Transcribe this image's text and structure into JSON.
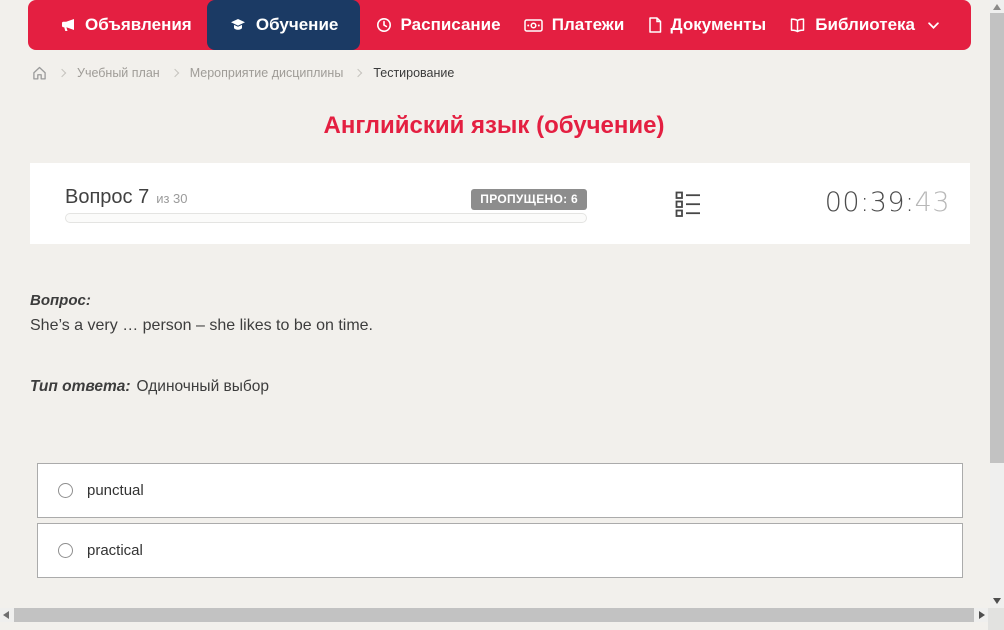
{
  "colors": {
    "accent_red": "#e41f41",
    "active_navy": "#1b3a64",
    "badge_gray": "#8d8d8d",
    "page_bg": "#f2f0ec"
  },
  "nav": {
    "items": [
      {
        "label": "Объявления",
        "icon": "megaphone-icon",
        "active": false
      },
      {
        "label": "Обучение",
        "icon": "graduation-cap-icon",
        "active": true
      },
      {
        "label": "Расписание",
        "icon": "clock-icon",
        "active": false
      },
      {
        "label": "Платежи",
        "icon": "cash-icon",
        "active": false
      },
      {
        "label": "Документы",
        "icon": "document-icon",
        "active": false
      },
      {
        "label": "Библиотека",
        "icon": "book-icon",
        "active": false,
        "has_dropdown": true,
        "dropdown_icon": "chevron-down-icon"
      }
    ]
  },
  "breadcrumb": {
    "home_icon": "home-icon",
    "items": [
      "Учебный план",
      "Мероприятие дисциплины",
      "Тестирование"
    ]
  },
  "page": {
    "title": "Английский язык (обучение)"
  },
  "question_panel": {
    "question_label": "Вопрос 7",
    "question_of": "из 30",
    "skipped_badge": "ПРОПУЩЕНО: 6",
    "progress_percent": 0,
    "question_list_icon": "question-list-icon",
    "timer_main": "00:39:",
    "timer_seconds": "43"
  },
  "question": {
    "label": "Вопрос:",
    "text": "She’s a very … person – she likes to be on time.",
    "answer_type_label": "Тип ответа:",
    "answer_type_value": "Одиночный выбор",
    "options": [
      {
        "label": "punctual",
        "selected": false
      },
      {
        "label": "practical",
        "selected": false
      }
    ]
  }
}
